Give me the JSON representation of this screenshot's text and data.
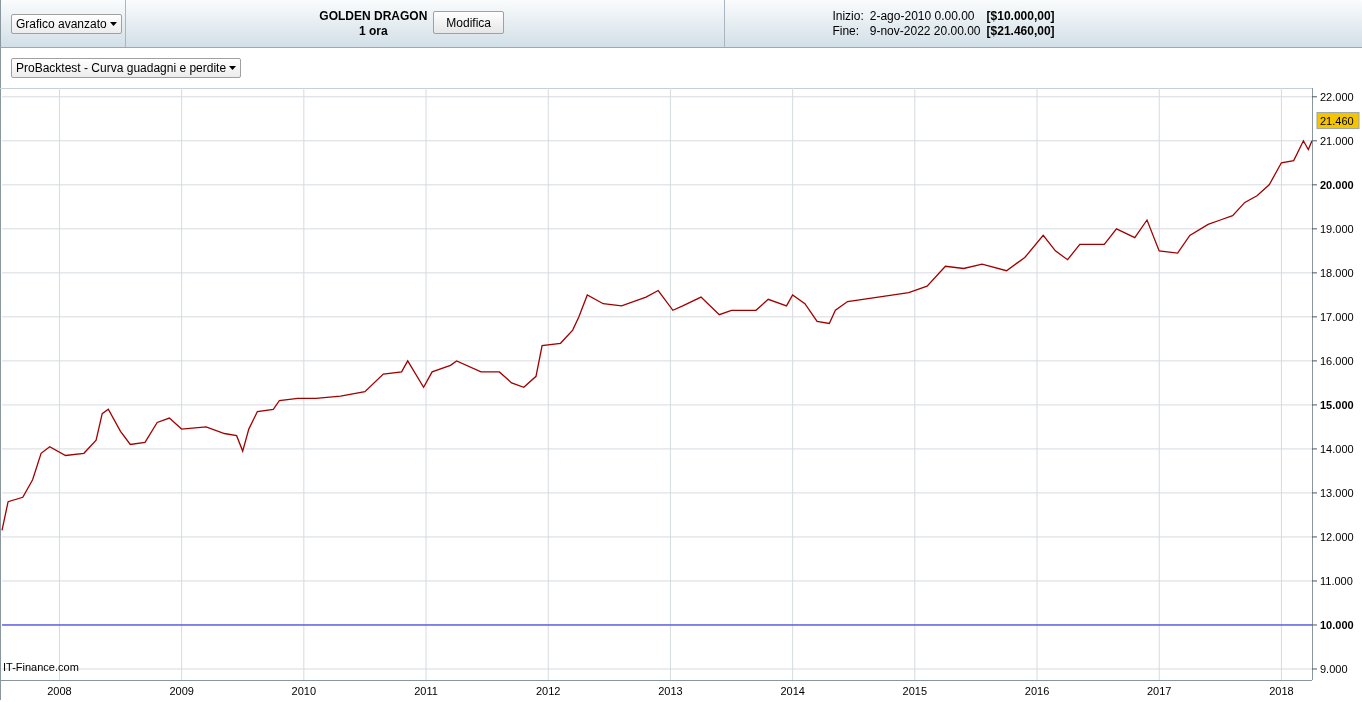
{
  "header": {
    "chart_menu": "Grafico avanzato",
    "instrument": "GOLDEN DRAGON",
    "timeframe": "1 ora",
    "edit_button": "Modifica",
    "range": [
      {
        "label": "Inizio:",
        "date": "2-ago-2010 0.00.00",
        "amount": "[$10.000,00]"
      },
      {
        "label": "Fine:",
        "date": "9-nov-2022 20.00.00",
        "amount": "[$21.460,00]"
      }
    ]
  },
  "toolbar": {
    "indicator_menu": "ProBacktest - Curva guadagni e perdite"
  },
  "chart": {
    "source_label": "IT-Finance.com",
    "last_value_label": "21.460",
    "chart_data": {
      "type": "line",
      "grid": true,
      "xlim": [
        2007.53,
        2018.25
      ],
      "ylim": [
        8750,
        22200
      ],
      "xticks": [
        {
          "value": 2008,
          "label": "2008"
        },
        {
          "value": 2009,
          "label": "2009"
        },
        {
          "value": 2010,
          "label": "2010"
        },
        {
          "value": 2011,
          "label": "2011"
        },
        {
          "value": 2012,
          "label": "2012"
        },
        {
          "value": 2013,
          "label": "2013"
        },
        {
          "value": 2014,
          "label": "2014"
        },
        {
          "value": 2015,
          "label": "2015"
        },
        {
          "value": 2016,
          "label": "2016"
        },
        {
          "value": 2017,
          "label": "2017"
        },
        {
          "value": 2018,
          "label": "2018"
        }
      ],
      "yticks": [
        {
          "value": 9000,
          "label": "9.000"
        },
        {
          "value": 10000,
          "label": "10.000"
        },
        {
          "value": 11000,
          "label": "11.000"
        },
        {
          "value": 12000,
          "label": "12.000"
        },
        {
          "value": 13000,
          "label": "13.000"
        },
        {
          "value": 14000,
          "label": "14.000"
        },
        {
          "value": 15000,
          "label": "15.000"
        },
        {
          "value": 16000,
          "label": "16.000"
        },
        {
          "value": 17000,
          "label": "17.000"
        },
        {
          "value": 18000,
          "label": "18.000"
        },
        {
          "value": 19000,
          "label": "19.000"
        },
        {
          "value": 20000,
          "label": "20.000"
        },
        {
          "value": 21000,
          "label": "21.000"
        },
        {
          "value": 22000,
          "label": "22.000"
        }
      ],
      "x": [
        2007.53,
        2007.58,
        2007.7,
        2007.78,
        2007.85,
        2007.92,
        2008.05,
        2008.2,
        2008.3,
        2008.35,
        2008.4,
        2008.5,
        2008.58,
        2008.7,
        2008.8,
        2008.9,
        2009.0,
        2009.2,
        2009.35,
        2009.45,
        2009.5,
        2009.55,
        2009.62,
        2009.75,
        2009.8,
        2009.95,
        2010.1,
        2010.3,
        2010.5,
        2010.65,
        2010.8,
        2010.85,
        2010.98,
        2011.05,
        2011.2,
        2011.25,
        2011.45,
        2011.6,
        2011.7,
        2011.8,
        2011.9,
        2011.95,
        2012.1,
        2012.2,
        2012.25,
        2012.32,
        2012.45,
        2012.6,
        2012.8,
        2012.9,
        2013.02,
        2013.1,
        2013.25,
        2013.4,
        2013.5,
        2013.7,
        2013.8,
        2013.95,
        2014.0,
        2014.1,
        2014.2,
        2014.3,
        2014.35,
        2014.45,
        2014.7,
        2014.95,
        2015.1,
        2015.25,
        2015.4,
        2015.55,
        2015.75,
        2015.9,
        2016.05,
        2016.15,
        2016.25,
        2016.35,
        2016.55,
        2016.65,
        2016.8,
        2016.9,
        2017.0,
        2017.15,
        2017.25,
        2017.4,
        2017.5,
        2017.6,
        2017.7,
        2017.8,
        2017.9,
        2018.0,
        2018.1,
        2018.18,
        2018.22,
        2018.25
      ],
      "series": [
        {
          "color": "#a00000",
          "values": [
            12150,
            12800,
            12900,
            13300,
            13900,
            14050,
            13850,
            13900,
            14200,
            14800,
            14900,
            14400,
            14100,
            14150,
            14600,
            14700,
            14450,
            14500,
            14350,
            14300,
            13950,
            14450,
            14850,
            14900,
            15100,
            15150,
            15150,
            15200,
            15300,
            15700,
            15750,
            16000,
            15400,
            15750,
            15900,
            16000,
            15750,
            15750,
            15500,
            15400,
            15650,
            16350,
            16400,
            16700,
            17000,
            17500,
            17300,
            17250,
            17450,
            17600,
            17150,
            17250,
            17450,
            17050,
            17150,
            17150,
            17400,
            17250,
            17500,
            17300,
            16900,
            16850,
            17150,
            17350,
            17450,
            17550,
            17700,
            18150,
            18100,
            18200,
            18050,
            18350,
            18850,
            18500,
            18300,
            18650,
            18650,
            19000,
            18800,
            19200,
            18500,
            18450,
            18850,
            19100,
            19200,
            19300,
            19600,
            19750,
            20000,
            20500,
            20550,
            21000,
            20800,
            21000
          ]
        }
      ],
      "ref_lines": [
        {
          "axis": "y",
          "value": 10000,
          "color": "#2020e0"
        }
      ]
    }
  }
}
